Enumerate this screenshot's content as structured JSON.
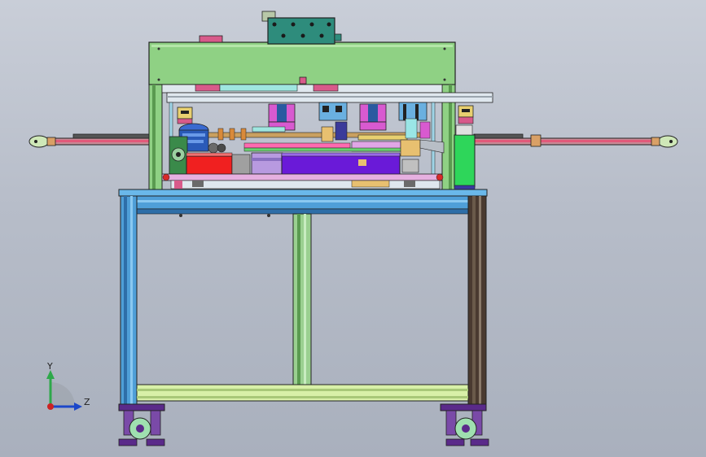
{
  "viewport": {
    "background_top": "#c9ced8",
    "background_bottom": "#a9b0bd"
  },
  "triad": {
    "y_label": "Y",
    "z_label": "Z",
    "y_color": "#2ea84a",
    "z_color": "#1c47c9",
    "origin_color": "#cc2222"
  },
  "colors": {
    "frame_green": "#8fd184",
    "frame_dark": "#3b3b3b",
    "table_blue": "#5aa7e0",
    "leg_blue": "#4f9fd8",
    "leg_brown": "#4a3a30",
    "rail_pink": "#e25a7a",
    "red_block": "#f02020",
    "violet_block": "#6a1ad8",
    "control_box": "#2e8c7c",
    "caster_purple": "#5a2a8a",
    "caster_wheel": "#9fe0b0"
  }
}
